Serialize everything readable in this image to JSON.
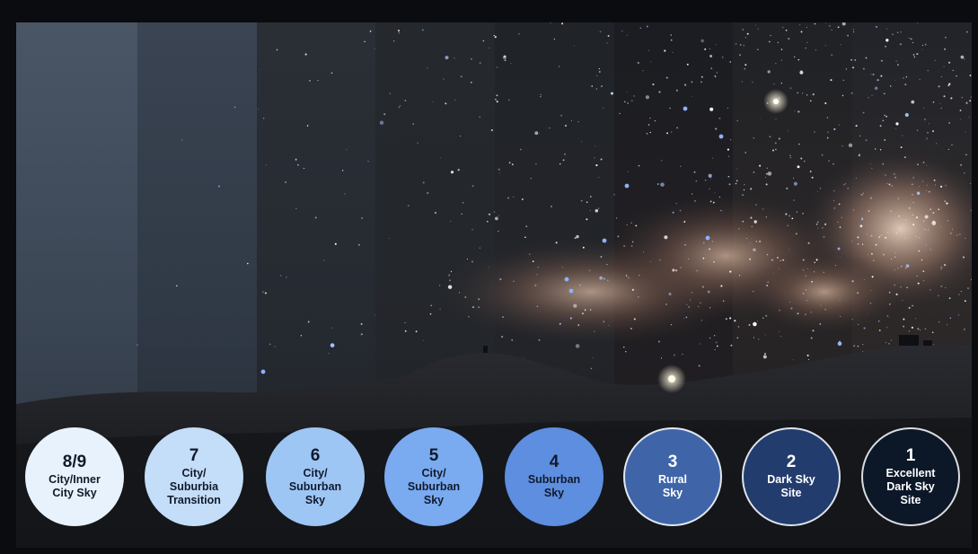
{
  "image": {
    "subject": "bortle-scale-night-sky",
    "colors": {
      "frame_background": "#0b0c10"
    }
  },
  "scale": [
    {
      "number": "8/9",
      "label": "City/Inner\nCity Sky",
      "color": "#e8f2fc"
    },
    {
      "number": "7",
      "label": "City/\nSuburbia\nTransition",
      "color": "#c4ddf8"
    },
    {
      "number": "6",
      "label": "City/\nSuburban\nSky",
      "color": "#9ec6f5"
    },
    {
      "number": "5",
      "label": "City/\nSuburban\nSky",
      "color": "#7aaaf0"
    },
    {
      "number": "4",
      "label": "Suburban\nSky",
      "color": "#5d8ee0"
    },
    {
      "number": "3",
      "label": "Rural\nSky",
      "color": "#3f65a8"
    },
    {
      "number": "2",
      "label": "Dark Sky\nSite",
      "color": "#233c6e"
    },
    {
      "number": "1",
      "label": "Excellent\nDark Sky\nSite",
      "color": "#0c1828"
    }
  ]
}
